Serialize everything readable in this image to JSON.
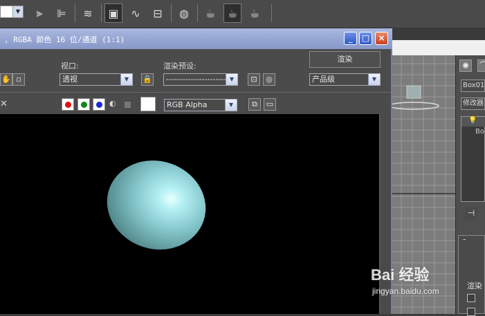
{
  "toolbar": {
    "icons": [
      "mirror-icon",
      "align-icon",
      "layer-manager-icon",
      "render-setup-icon",
      "curve-editor-icon",
      "render-frame-icon",
      "material-editor-icon",
      "render-production-icon",
      "render-iterative-icon",
      "teapot-render-icon"
    ],
    "active": [
      "render-setup-icon",
      "render-iterative-icon"
    ]
  },
  "render_window": {
    "title": ", RGBA 颜色 16 位/通道 (1:1)",
    "viewport_label": "视口:",
    "viewport_value": "透视",
    "preset_label": "渲染预设:",
    "preset_value": "----------------------------------",
    "render_button": "渲染",
    "quality_value": "产品级",
    "channel_display": "RGB Alpha",
    "channels": [
      {
        "name": "red",
        "color": "#e01010"
      },
      {
        "name": "green",
        "color": "#0e8a1a"
      },
      {
        "name": "blue",
        "color": "#1a2ad8"
      }
    ],
    "sphere_color": "#86c8cc",
    "window_controls": {
      "minimize": "_",
      "maximize": "□",
      "close": "×"
    }
  },
  "command_panel": {
    "object_name": "Box01",
    "modifier_list": "修改器",
    "stack_item": "Bo",
    "rollout_label": "渲染"
  },
  "watermark": {
    "main": "Bai 经验",
    "sub": "jingyan.baidu.com"
  }
}
